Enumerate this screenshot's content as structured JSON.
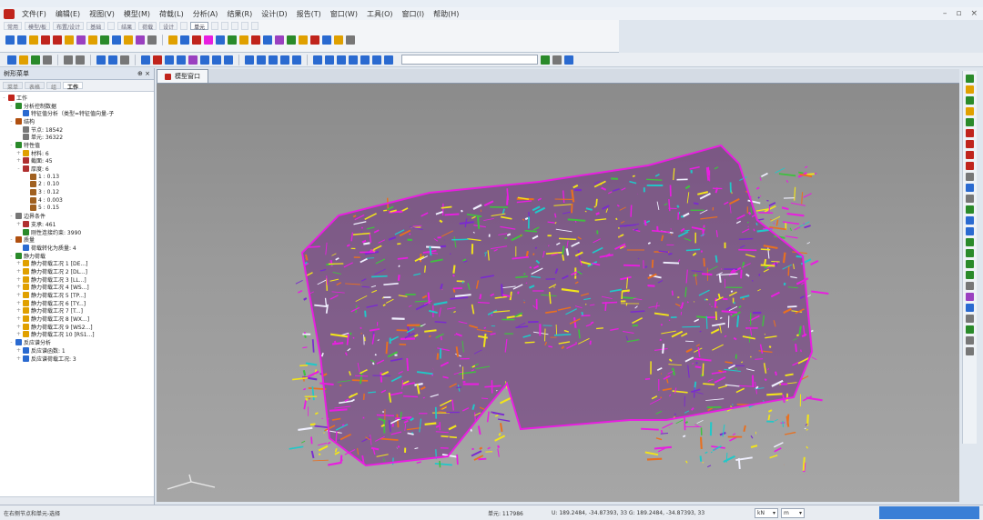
{
  "menu": {
    "items": [
      "文件(F)",
      "编辑(E)",
      "视图(V)",
      "模型(M)",
      "荷载(L)",
      "分析(A)",
      "结果(R)",
      "设计(D)",
      "报告(T)",
      "窗口(W)",
      "工具(O)",
      "窗口(I)",
      "帮助(H)"
    ]
  },
  "ribbon": {
    "tabs": [
      "常用",
      "模型/板",
      "布置/设计",
      "基础",
      "",
      "结果",
      "荷载",
      "设计",
      "",
      "单元",
      "",
      "",
      "",
      "",
      ""
    ],
    "active_tab": "单元"
  },
  "panel": {
    "title": "树形菜单",
    "tabs": [
      "菜单",
      "表格",
      "组",
      "工作"
    ],
    "active_tab": "工作",
    "tree": [
      {
        "level": 0,
        "expander": "-",
        "icon": "work-icon",
        "color": "#c0241c",
        "label": "工作"
      },
      {
        "level": 1,
        "expander": "-",
        "icon": "analysis-data-icon",
        "color": "#2a8a2a",
        "label": "分析控制数据"
      },
      {
        "level": 2,
        "expander": "",
        "icon": "feature-icon",
        "color": "#2a6ad0",
        "label": "特征值分析（类型=特征值向量-子"
      },
      {
        "level": 1,
        "expander": "-",
        "icon": "structure-icon",
        "color": "#b05010",
        "label": "结构"
      },
      {
        "level": 2,
        "expander": "",
        "icon": "node-icon",
        "color": "#777777",
        "label": "节点: 18542"
      },
      {
        "level": 2,
        "expander": "",
        "icon": "element-icon",
        "color": "#777777",
        "label": "单元: 36322"
      },
      {
        "level": 1,
        "expander": "-",
        "icon": "property-icon",
        "color": "#2a8a2a",
        "label": "特性值"
      },
      {
        "level": 2,
        "expander": "+",
        "icon": "material-icon",
        "color": "#e0a000",
        "label": "材料: 6"
      },
      {
        "level": 2,
        "expander": "+",
        "icon": "section-icon",
        "color": "#b03030",
        "label": "截面: 45"
      },
      {
        "level": 2,
        "expander": "-",
        "icon": "thickness-icon",
        "color": "#b03030",
        "label": "厚度: 6"
      },
      {
        "level": 3,
        "expander": "",
        "icon": "thick-item-icon",
        "color": "#a06020",
        "label": "1 : 0.13"
      },
      {
        "level": 3,
        "expander": "",
        "icon": "thick-item-icon",
        "color": "#a06020",
        "label": "2 : 0.10"
      },
      {
        "level": 3,
        "expander": "",
        "icon": "thick-item-icon",
        "color": "#a06020",
        "label": "3 : 0.12"
      },
      {
        "level": 3,
        "expander": "",
        "icon": "thick-item-icon",
        "color": "#a06020",
        "label": "4 : 0.003"
      },
      {
        "level": 3,
        "expander": "",
        "icon": "thick-item-icon",
        "color": "#a06020",
        "label": "5 : 0.15"
      },
      {
        "level": 1,
        "expander": "-",
        "icon": "boundary-icon",
        "color": "#777777",
        "label": "边界条件"
      },
      {
        "level": 2,
        "expander": "+",
        "icon": "support-icon",
        "color": "#b03030",
        "label": "支承: 461"
      },
      {
        "level": 2,
        "expander": "",
        "icon": "rigid-icon",
        "color": "#2a8a2a",
        "label": "刚性连接约束: 3990"
      },
      {
        "level": 1,
        "expander": "-",
        "icon": "mass-icon",
        "color": "#b05010",
        "label": "质量"
      },
      {
        "level": 2,
        "expander": "",
        "icon": "load-to-mass-icon",
        "color": "#2a6ad0",
        "label": "荷载转化为质量: 4"
      },
      {
        "level": 1,
        "expander": "-",
        "icon": "static-load-icon",
        "color": "#2a8a2a",
        "label": "静力荷载"
      },
      {
        "level": 2,
        "expander": "+",
        "icon": "load-case-icon",
        "color": "#e0a000",
        "label": "静力荷载工况 1 [DE...]"
      },
      {
        "level": 2,
        "expander": "+",
        "icon": "load-case-icon",
        "color": "#e0a000",
        "label": "静力荷载工况 2 [DL...]"
      },
      {
        "level": 2,
        "expander": "+",
        "icon": "load-case-icon",
        "color": "#e0a000",
        "label": "静力荷载工况 3 [LL...]"
      },
      {
        "level": 2,
        "expander": "+",
        "icon": "load-case-icon",
        "color": "#e0a000",
        "label": "静力荷载工况 4 [WS...]"
      },
      {
        "level": 2,
        "expander": "+",
        "icon": "load-case-icon",
        "color": "#e0a000",
        "label": "静力荷载工况 5 [TP...]"
      },
      {
        "level": 2,
        "expander": "+",
        "icon": "load-case-icon",
        "color": "#e0a000",
        "label": "静力荷载工况 6 [TY...]"
      },
      {
        "level": 2,
        "expander": "+",
        "icon": "load-case-icon",
        "color": "#e0a000",
        "label": "静力荷载工况 7 [T...]"
      },
      {
        "level": 2,
        "expander": "+",
        "icon": "load-case-icon",
        "color": "#e0a000",
        "label": "静力荷载工况 8 [WX...]"
      },
      {
        "level": 2,
        "expander": "+",
        "icon": "load-case-icon",
        "color": "#e0a000",
        "label": "静力荷载工况 9 [WS2...]"
      },
      {
        "level": 2,
        "expander": "+",
        "icon": "load-case-icon",
        "color": "#e0a000",
        "label": "静力荷载工况 10 [RS1...]"
      },
      {
        "level": 1,
        "expander": "-",
        "icon": "response-icon",
        "color": "#2a6ad0",
        "label": "反应谱分析"
      },
      {
        "level": 2,
        "expander": "+",
        "icon": "spectrum-fn-icon",
        "color": "#2a6ad0",
        "label": "反应谱函数: 1"
      },
      {
        "level": 2,
        "expander": "+",
        "icon": "spectrum-case-icon",
        "color": "#2a6ad0",
        "label": "反应谱荷载工况: 3"
      }
    ]
  },
  "viewport": {
    "tab_label": "模型窗口",
    "colors": {
      "magenta": "#e81ee0",
      "yellow": "#f2e41a",
      "cyan": "#20c8c8",
      "green": "#40c040",
      "purple": "#7a2ad0",
      "orange": "#e87020",
      "white": "#f0f0ff"
    }
  },
  "statusbar": {
    "left_text": "在右侧节点和单元-选择",
    "elem_text": "单元: 117986",
    "coord_text": "U: 189.2484, -34.87393, 33 G: 189.2484, -34.87393, 33",
    "unit1": "kN",
    "unit2": "m"
  }
}
